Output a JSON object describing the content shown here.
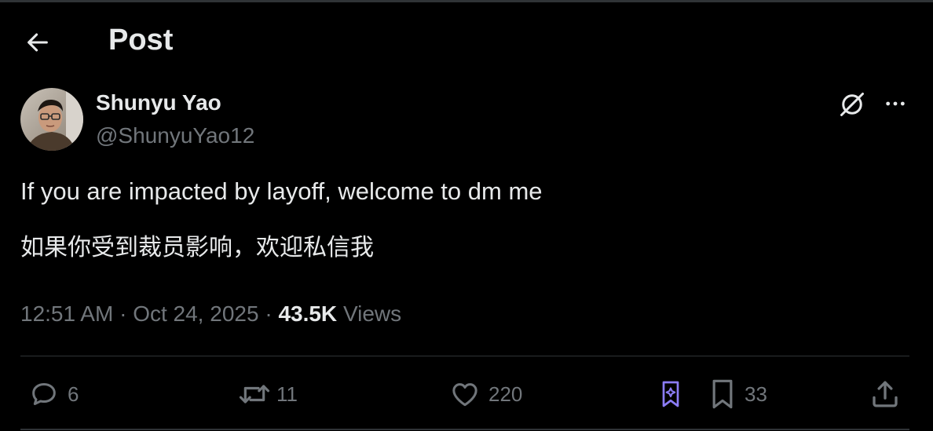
{
  "header": {
    "title": "Post"
  },
  "author": {
    "name": "Shunyu Yao",
    "handle": "@ShunyuYao12"
  },
  "post": {
    "lines": [
      "If you are impacted by layoff, welcome to dm me",
      "如果你受到裁员影响，欢迎私信我"
    ],
    "time": "12:51 AM",
    "separator": " · ",
    "date": "Oct 24, 2025",
    "views_count": "43.5K",
    "views_label": "Views"
  },
  "actions": {
    "replies": "6",
    "reposts": "11",
    "likes": "220",
    "bookmarks": "33"
  },
  "colors": {
    "background": "#000000",
    "text": "#e7e9ea",
    "muted": "#71767b",
    "divider": "#2f3336",
    "grok_accent": "#8b7cf6"
  },
  "icons": {
    "back": "arrow-left-icon",
    "grok": "grok-icon",
    "more": "more-horizontal-icon",
    "reply": "reply-icon",
    "repost": "repost-icon",
    "like": "heart-icon",
    "grok_bookmark": "grok-bookmark-icon",
    "bookmark": "bookmark-icon",
    "share": "share-icon"
  }
}
